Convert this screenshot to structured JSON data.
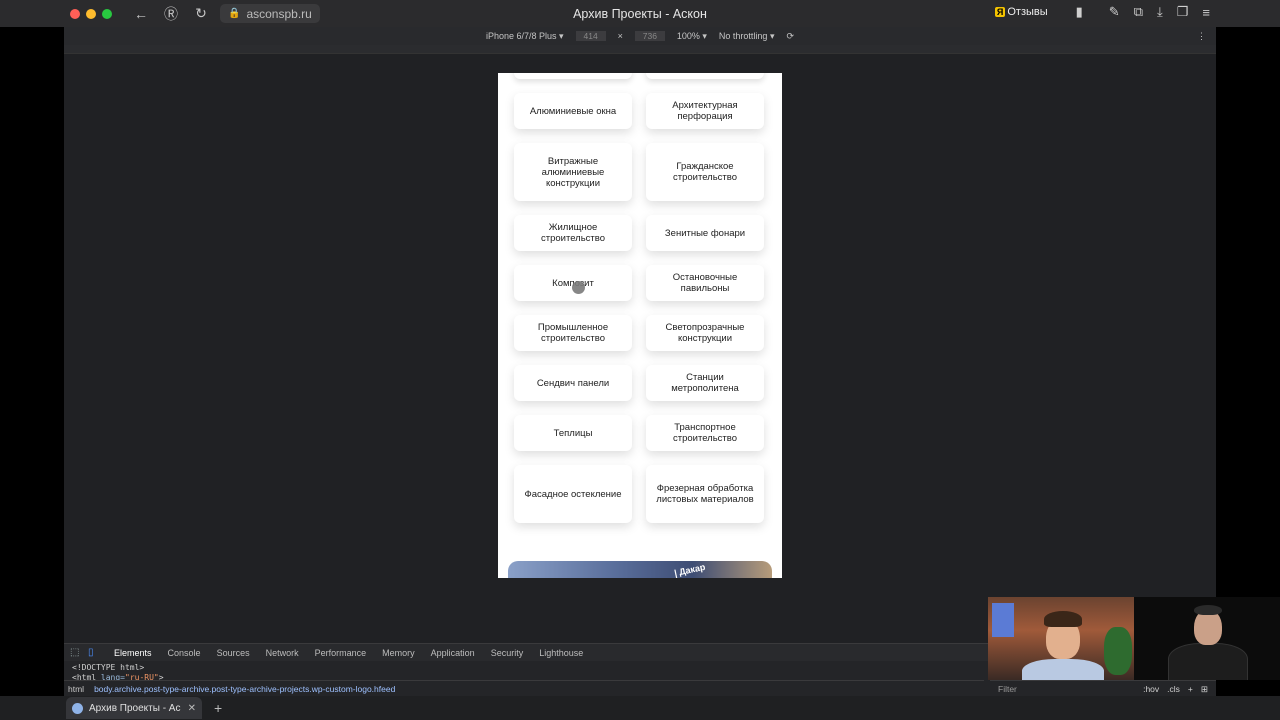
{
  "browser": {
    "url": "asconspb.ru",
    "window_title": "Архив Проекты - Аскон",
    "extension_label": "Отзывы"
  },
  "device_toolbar": {
    "device": "iPhone 6/7/8 Plus",
    "width": "414",
    "height": "736",
    "zoom": "100%",
    "throttling": "No throttling"
  },
  "categories": [
    "Алюминиевые окна",
    "Архитектурная перфорация",
    "Витражные алюминиевые конструкции",
    "Гражданское строительство",
    "Жилищное строительство",
    "Зенитные фонари",
    "Композит",
    "Остановочные павильоны",
    "Промышленное строительство",
    "Светопрозрачные конструкции",
    "Сендвич панели",
    "Станции метрополитена",
    "Теплицы",
    "Транспортное строительство",
    "Фасадное остекление",
    "Фрезерная обработка листовых материалов"
  ],
  "promo": {
    "text": "| Дакар"
  },
  "devtools": {
    "tabs": [
      "Elements",
      "Console",
      "Sources",
      "Network",
      "Performance",
      "Memory",
      "Application",
      "Security",
      "Lighthouse"
    ],
    "active_tab": "Elements",
    "code_line1": "<!DOCTYPE html>",
    "code_line2_tag": "<html ",
    "code_line2_attr": "lang=",
    "code_line2_val": "\"ru-RU\"",
    "code_line2_end": ">",
    "breadcrumb_html": "html",
    "breadcrumb_body": "body.archive.post-type-archive.post-type-archive-projects.wp-custom-logo.hfeed",
    "filter_placeholder": "Filter",
    "hov": ":hov",
    "cls": ".cls"
  },
  "tab": {
    "title": "Архив Проекты - Аскон"
  }
}
